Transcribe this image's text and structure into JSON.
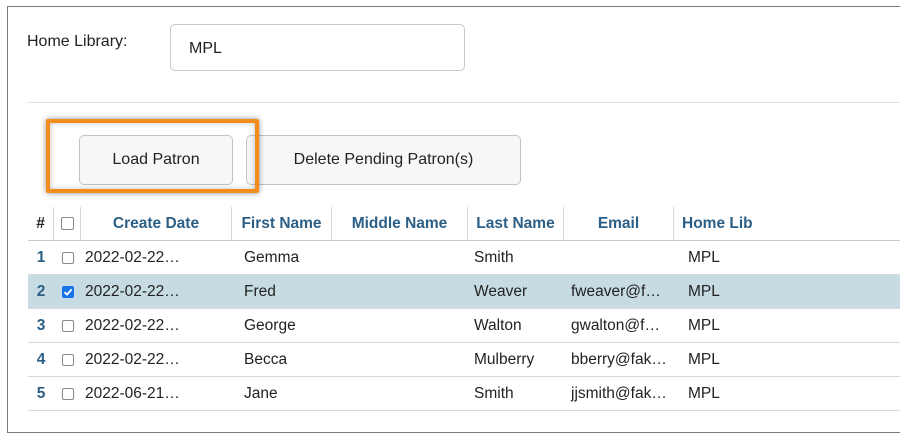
{
  "home_library": {
    "label": "Home Library:",
    "value": "MPL"
  },
  "buttons": {
    "load_patron": "Load Patron",
    "delete_pending": "Delete Pending Patron(s)"
  },
  "table": {
    "headers": {
      "num": "#",
      "create_date": "Create Date",
      "first_name": "First Name",
      "middle_name": "Middle Name",
      "last_name": "Last Name",
      "email": "Email",
      "home_lib": "Home Lib"
    },
    "rows": [
      {
        "num": "1",
        "checked": false,
        "create_date": "2022-02-22…",
        "first_name": "Gemma",
        "middle_name": "",
        "last_name": "Smith",
        "email": "",
        "home_lib": "MPL"
      },
      {
        "num": "2",
        "checked": true,
        "create_date": "2022-02-22…",
        "first_name": "Fred",
        "middle_name": "",
        "last_name": "Weaver",
        "email": "fweaver@f…",
        "home_lib": "MPL"
      },
      {
        "num": "3",
        "checked": false,
        "create_date": "2022-02-22…",
        "first_name": "George",
        "middle_name": "",
        "last_name": "Walton",
        "email": "gwalton@f…",
        "home_lib": "MPL"
      },
      {
        "num": "4",
        "checked": false,
        "create_date": "2022-02-22…",
        "first_name": "Becca",
        "middle_name": "",
        "last_name": "Mulberry",
        "email": "bberry@fak…",
        "home_lib": "MPL"
      },
      {
        "num": "5",
        "checked": false,
        "create_date": "2022-06-21…",
        "first_name": "Jane",
        "middle_name": "",
        "last_name": "Smith",
        "email": "jjsmith@fak…",
        "home_lib": "MPL"
      }
    ]
  },
  "colors": {
    "highlight": "#f28c1f",
    "selected_row": "#c7dbe2",
    "header_text": "#2c5f86",
    "checkbox_checked": "#1a73e8"
  }
}
